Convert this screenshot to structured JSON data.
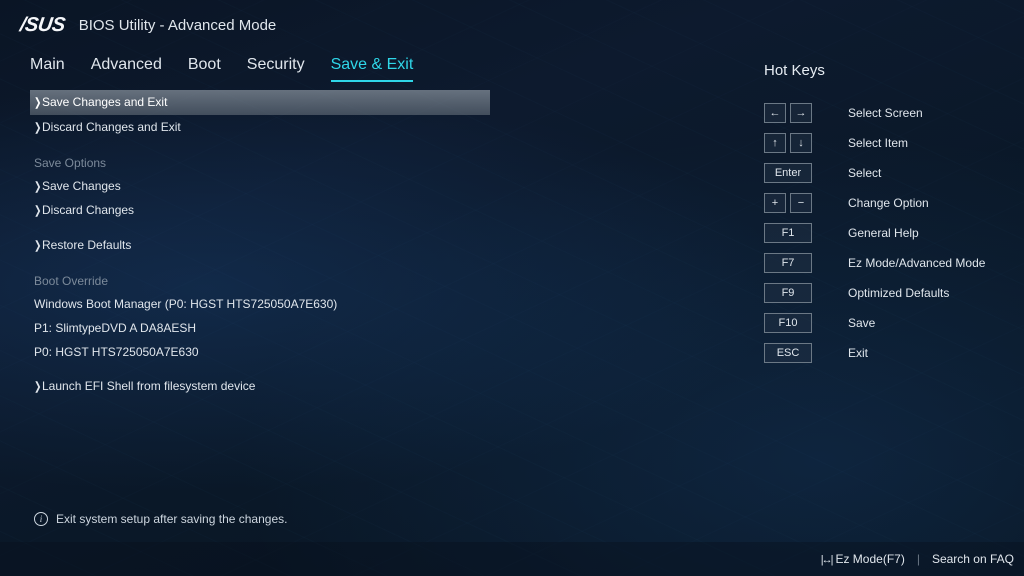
{
  "header": {
    "brand": "/SUS",
    "title": "BIOS Utility - Advanced Mode"
  },
  "tabs": [
    "Main",
    "Advanced",
    "Boot",
    "Security",
    "Save & Exit"
  ],
  "active_tab": 4,
  "menu": [
    {
      "type": "item",
      "label": "Save Changes and Exit",
      "highlight": true
    },
    {
      "type": "item",
      "label": "Discard Changes and Exit"
    },
    {
      "type": "header",
      "label": "Save Options"
    },
    {
      "type": "item",
      "label": "Save Changes"
    },
    {
      "type": "item",
      "label": "Discard Changes"
    },
    {
      "type": "spacer"
    },
    {
      "type": "item",
      "label": "Restore Defaults"
    },
    {
      "type": "header",
      "label": "Boot Override"
    },
    {
      "type": "sub",
      "label": "Windows Boot Manager (P0: HGST HTS725050A7E630)"
    },
    {
      "type": "sub",
      "label": "P1: SlimtypeDVD A  DA8AESH"
    },
    {
      "type": "sub",
      "label": "P0: HGST HTS725050A7E630"
    },
    {
      "type": "spacer"
    },
    {
      "type": "item",
      "label": "Launch EFI Shell from filesystem device"
    }
  ],
  "info_text": "Exit system setup after saving the changes.",
  "hotkeys_title": "Hot Keys",
  "hotkeys": [
    {
      "keys": [
        "←",
        "→"
      ],
      "label": "Select Screen",
      "pair": true
    },
    {
      "keys": [
        "↑",
        "↓"
      ],
      "label": "Select Item",
      "pair": true
    },
    {
      "keys": [
        "Enter"
      ],
      "label": "Select"
    },
    {
      "keys": [
        "+",
        "−"
      ],
      "label": "Change Option",
      "pair": true
    },
    {
      "keys": [
        "F1"
      ],
      "label": "General Help"
    },
    {
      "keys": [
        "F7"
      ],
      "label": "Ez Mode/Advanced Mode"
    },
    {
      "keys": [
        "F9"
      ],
      "label": "Optimized Defaults"
    },
    {
      "keys": [
        "F10"
      ],
      "label": "Save"
    },
    {
      "keys": [
        "ESC"
      ],
      "label": "Exit"
    }
  ],
  "footer": {
    "ez_mode": "Ez Mode(F7)",
    "search": "Search on FAQ"
  }
}
